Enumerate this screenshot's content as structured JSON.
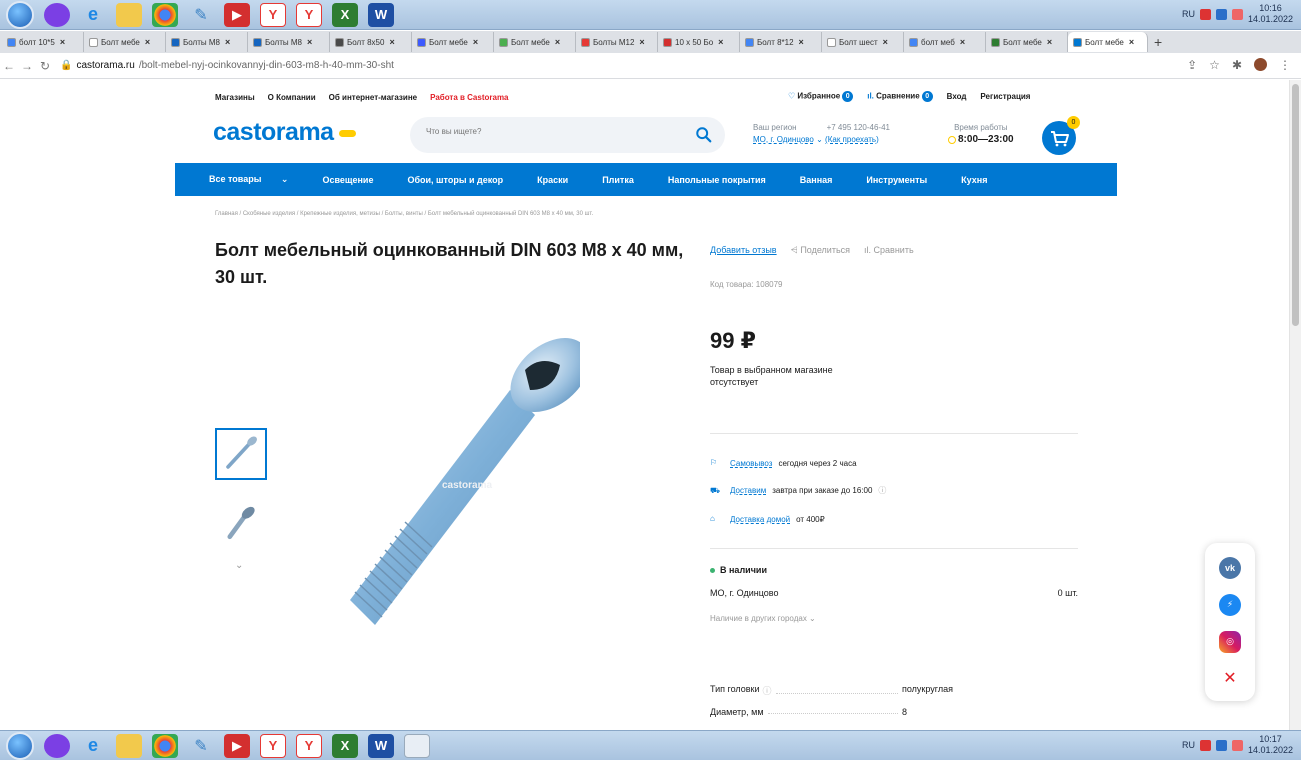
{
  "taskbar": {
    "lang": "RU",
    "top_time": "10:16",
    "top_date": "14.01.2022",
    "bottom_time": "10:17",
    "bottom_date": "14.01.2022"
  },
  "tabs": [
    {
      "label": "болт 10*5",
      "color": "#4285f4"
    },
    {
      "label": "Болт мебе",
      "color": "#ffffff"
    },
    {
      "label": "Болты М8",
      "color": "#1565c0"
    },
    {
      "label": "Болты М8",
      "color": "#1565c0"
    },
    {
      "label": "Болт 8х50",
      "color": "#4a4a4a"
    },
    {
      "label": "Болт мебе",
      "color": "#3d5afe"
    },
    {
      "label": "Болт мебе",
      "color": "#4caf50"
    },
    {
      "label": "Болты М12",
      "color": "#e53935"
    },
    {
      "label": "10 x 50 Бо",
      "color": "#d32f2f"
    },
    {
      "label": "Болт 8*12",
      "color": "#4285f4"
    },
    {
      "label": "Болт шест",
      "color": "#ffffff"
    },
    {
      "label": "болт меб",
      "color": "#4285f4"
    },
    {
      "label": "Болт мебе",
      "color": "#2e7d32"
    },
    {
      "label": "Болт мебе",
      "color": "#0078d2"
    }
  ],
  "address": {
    "host": "castorama.ru",
    "path": "/bolt-mebel-nyj-ocinkovannyj-din-603-m8-h-40-mm-30-sht"
  },
  "header": {
    "nav": [
      "Магазины",
      "О Компании",
      "Об интернет-магазине"
    ],
    "nav_highlight": "Работа в Castorama",
    "favorites": "Избранное",
    "favorites_count": "0",
    "compare": "Сравнение",
    "compare_count": "0",
    "login": "Вход",
    "register": "Регистрация",
    "logo": "castorama",
    "search_placeholder": "Что вы ищете?",
    "region_label": "Ваш регион",
    "region_value": "МО, г. Одинцово",
    "phone": "+7 495 120-46-41",
    "directions": "(Как проехать)",
    "hours_label": "Время работы",
    "hours_value": "8:00—23:00",
    "cart_count": "0"
  },
  "categories": [
    "Все товары",
    "Освещение",
    "Обои, шторы и декор",
    "Краски",
    "Плитка",
    "Напольные покрытия",
    "Ванная",
    "Инструменты",
    "Кухня"
  ],
  "breadcrumb": "Главная / Скобяные изделия / Крепежные изделия, метизы / Болты, винты / Болт мебельный оцинкованный DIN 603 M8 x 40 мм, 30 шт.",
  "product": {
    "title": "Болт мебельный оцинкованный DIN 603 M8 x 40 мм, 30 шт.",
    "add_review": "Добавить отзыв",
    "share": "Поделиться",
    "compare": "Сравнить",
    "code": "Код товара: 108079",
    "price": "99 ₽",
    "availability_note": "Товар в выбранном магазине отсутствует",
    "watermark": "castorama",
    "pickup_link": "Самовывоз",
    "pickup_text": "сегодня через 2 часа",
    "delivery_link": "Доставим",
    "delivery_text": "завтра при заказе до 16:00",
    "home_link": "Доставка домой",
    "home_text": "от 400₽",
    "stock_title": "В наличии",
    "store_name": "МО, г. Одинцово",
    "store_qty": "0 шт.",
    "other_cities": "Наличие в других городах",
    "specs": [
      {
        "key": "Тип головки",
        "value": "полукруглая"
      },
      {
        "key": "Диаметр, мм",
        "value": "8"
      }
    ]
  }
}
